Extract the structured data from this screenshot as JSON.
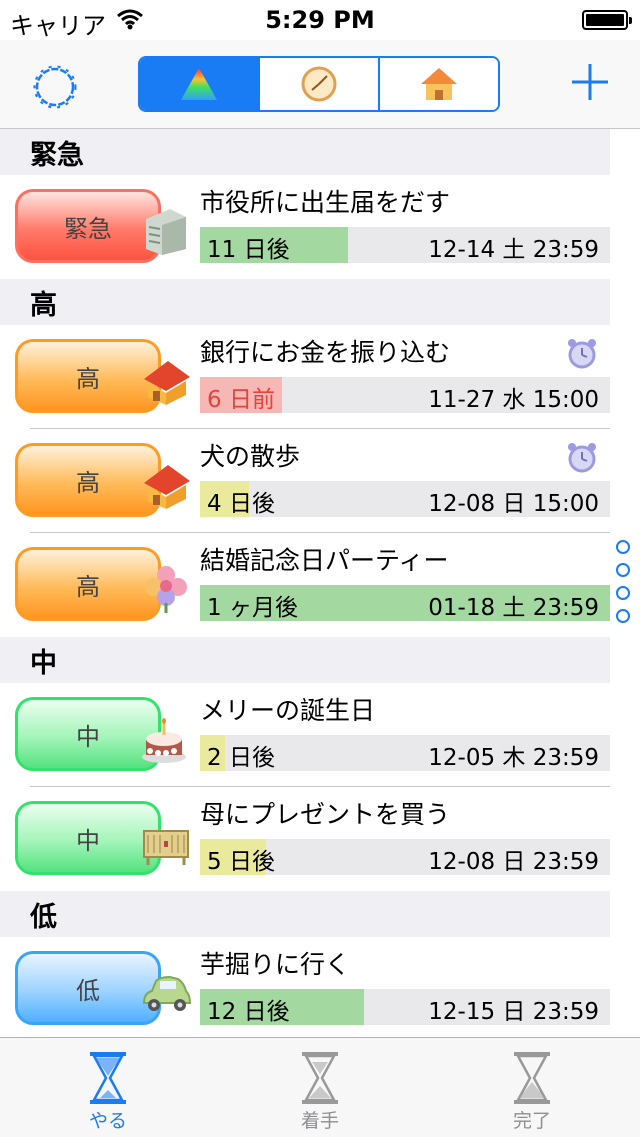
{
  "status_bar": {
    "carrier": "キャリア",
    "time": "5:29 PM"
  },
  "navbar": {
    "segments": [
      {
        "name": "priority",
        "icon": "pyramid-icon",
        "selected": true
      },
      {
        "name": "time",
        "icon": "clock-icon",
        "selected": false
      },
      {
        "name": "category",
        "icon": "house-icon",
        "selected": false
      }
    ],
    "accent_color": "#1a7cf5"
  },
  "sections": [
    {
      "header": "緊急",
      "items": [
        {
          "priority": "緊急",
          "category_icon": "building-icon",
          "title": "市役所に出生届をだす",
          "relative": "11 日後",
          "due": "12-14 土 23:59",
          "progress": 0.36,
          "bar_color": "#a3d8a0",
          "overdue": false,
          "alarm": false
        }
      ]
    },
    {
      "header": "高",
      "items": [
        {
          "priority": "高",
          "category_icon": "house-icon",
          "title": "銀行にお金を振り込む",
          "relative": "6 日前",
          "due": "11-27 水 15:00",
          "progress": 0.2,
          "bar_color": "#f5b8b4",
          "overdue": true,
          "alarm": true
        },
        {
          "priority": "高",
          "category_icon": "house-icon",
          "title": "犬の散歩",
          "relative": "4 日後",
          "due": "12-08 日 15:00",
          "progress": 0.12,
          "bar_color": "#eaea9c",
          "overdue": false,
          "alarm": true
        },
        {
          "priority": "高",
          "category_icon": "flower-icon",
          "title": "結婚記念日パーティー",
          "relative": "1 ヶ月後",
          "due": "01-18 土 23:59",
          "progress": 1.0,
          "bar_color": "#a3d8a0",
          "overdue": false,
          "alarm": false
        }
      ]
    },
    {
      "header": "中",
      "items": [
        {
          "priority": "中",
          "category_icon": "cake-icon",
          "title": "メリーの誕生日",
          "relative": "2 日後",
          "due": "12-05 木 23:59",
          "progress": 0.06,
          "bar_color": "#eaea9c",
          "overdue": false,
          "alarm": false
        },
        {
          "priority": "中",
          "category_icon": "gift-box-icon",
          "title": "母にプレゼントを買う",
          "relative": "5 日後",
          "due": "12-08 日 23:59",
          "progress": 0.16,
          "bar_color": "#eaea9c",
          "overdue": false,
          "alarm": false
        }
      ]
    },
    {
      "header": "低",
      "items": [
        {
          "priority": "低",
          "category_icon": "car-icon",
          "title": "芋掘りに行く",
          "relative": "12 日後",
          "due": "12-15 日 23:59",
          "progress": 0.4,
          "bar_color": "#a3d8a0",
          "overdue": false,
          "alarm": false
        }
      ]
    }
  ],
  "tabs": [
    {
      "label": "やる",
      "icon": "hourglass-icon",
      "active": true
    },
    {
      "label": "着手",
      "icon": "hourglass-icon",
      "active": false
    },
    {
      "label": "完了",
      "icon": "hourglass-icon",
      "active": false
    }
  ]
}
